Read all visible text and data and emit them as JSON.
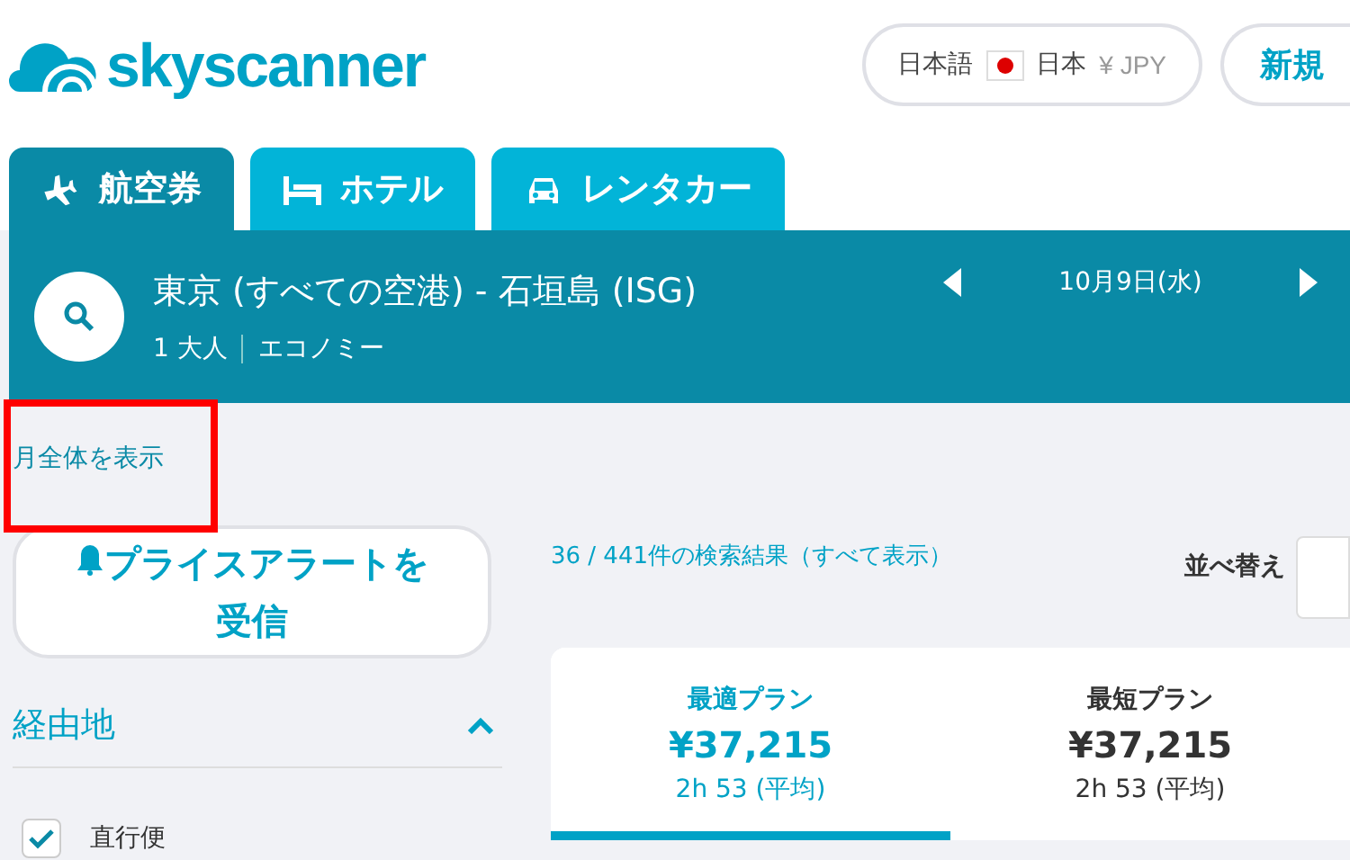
{
  "header": {
    "logo": "skyscanner",
    "locale": {
      "language": "日本語",
      "country": "日本",
      "currency": "¥ JPY"
    },
    "signup": "新規"
  },
  "tabs": [
    {
      "label": "航空券",
      "kind": "plane",
      "selected": true
    },
    {
      "label": "ホテル",
      "kind": "bed",
      "selected": false
    },
    {
      "label": "レンタカー",
      "kind": "car",
      "selected": false
    }
  ],
  "search": {
    "route": "東京 (すべての空港) - 石垣島 (ISG)",
    "date": "10月9日(水)",
    "passengers": "1 大人",
    "cabin": "エコノミー"
  },
  "month_link": {
    "label": "月全体を表示",
    "highlighted": true
  },
  "price_alert": "プライスアラートを受信",
  "results": {
    "count": "36 / 441件の検索結果（すべて表示）",
    "sort_label": "並べ替え"
  },
  "filters": [
    {
      "title": "経由地",
      "expanded": true,
      "options": [
        {
          "label": "直行便",
          "checked": true
        }
      ]
    }
  ],
  "plans": [
    {
      "title": "最適プラン",
      "price": "¥37,215",
      "duration": "2h 53 (平均)",
      "selected": true
    },
    {
      "title": "最短プラン",
      "price": "¥37,215",
      "duration": "2h 53 (平均)",
      "selected": false
    }
  ]
}
